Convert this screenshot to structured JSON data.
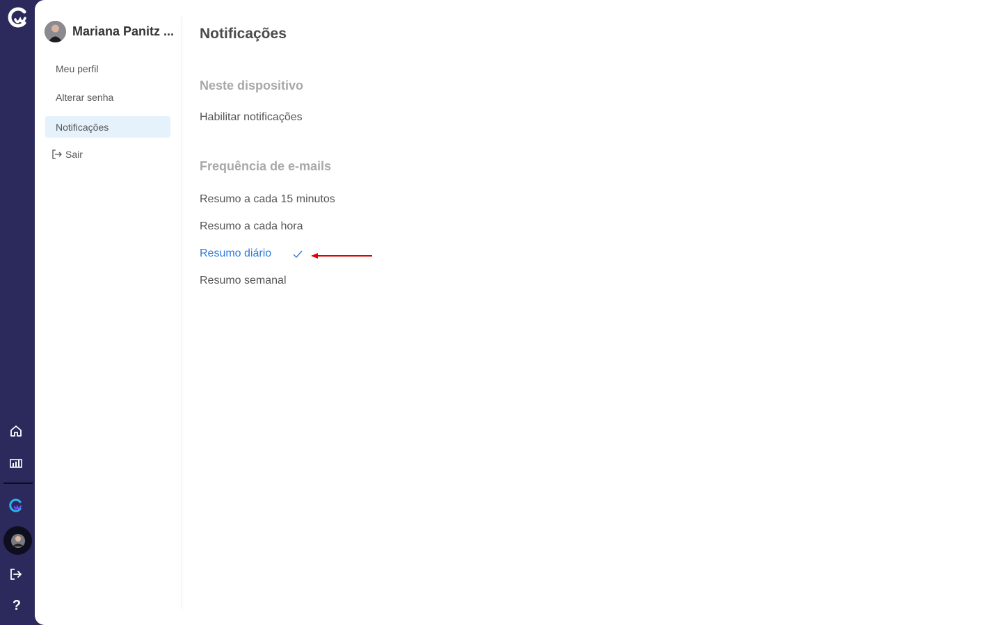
{
  "colors": {
    "rail": "#2c2a5c",
    "accent": "#2f7bd9",
    "active_bg": "#e5f1fb",
    "annotation_arrow": "#e00000"
  },
  "rail": {
    "icons": [
      "app-logo-icon",
      "home-icon",
      "reports-icon",
      "brand-icon",
      "avatar",
      "logout-icon",
      "help-icon"
    ],
    "help_label": "?"
  },
  "sidebar": {
    "user_name": "Mariana Panitz ...",
    "items": [
      {
        "label": "Meu perfil",
        "active": false
      },
      {
        "label": "Alterar senha",
        "active": false
      },
      {
        "label": "Notificações",
        "active": true
      },
      {
        "label": "Sair",
        "icon": "logout-icon",
        "active": false
      }
    ]
  },
  "main": {
    "title": "Notificações",
    "device_section": {
      "heading": "Neste dispositivo",
      "option": "Habilitar notificações"
    },
    "email_section": {
      "heading": "Frequência de e-mails",
      "options": [
        {
          "label": "Resumo a cada 15 minutos",
          "selected": false
        },
        {
          "label": "Resumo a cada hora",
          "selected": false
        },
        {
          "label": "Resumo diário",
          "selected": true
        },
        {
          "label": "Resumo semanal",
          "selected": false
        }
      ]
    }
  }
}
